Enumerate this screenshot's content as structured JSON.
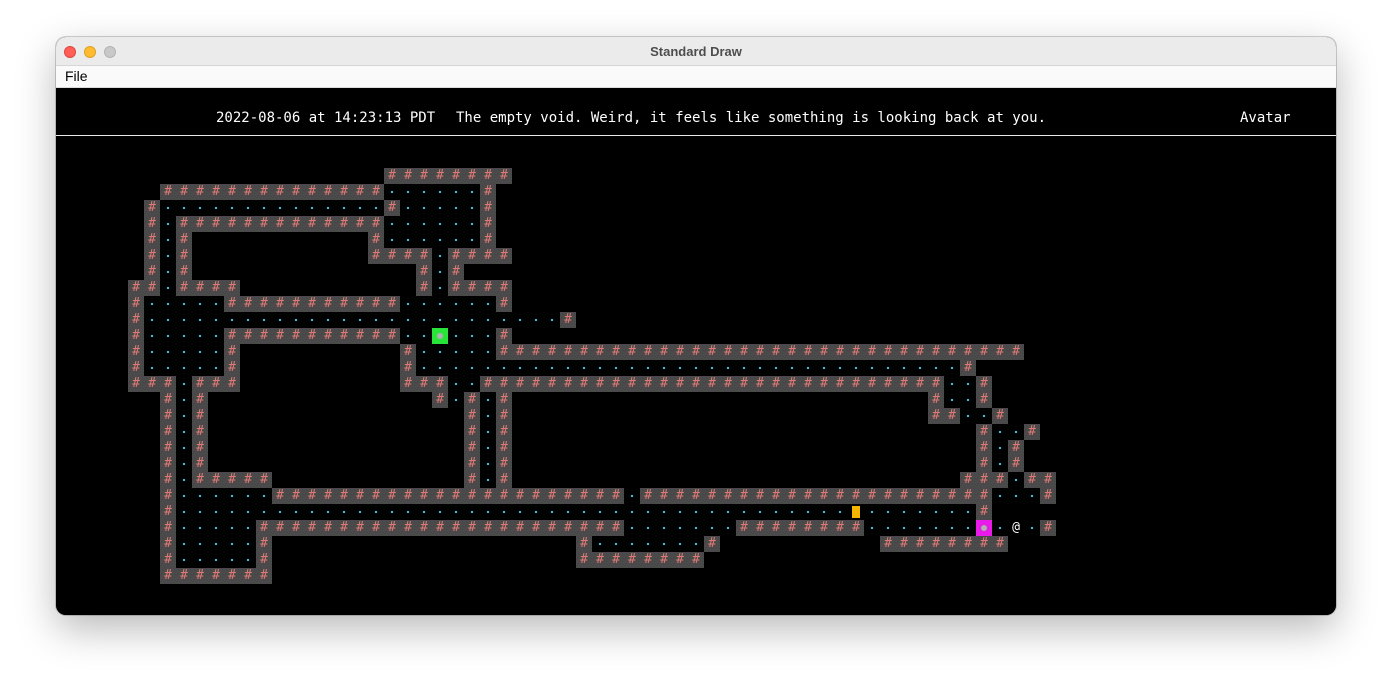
{
  "window": {
    "title": "Standard Draw",
    "menu": [
      "File"
    ]
  },
  "hud": {
    "datetime": "2022-08-06 at 14:23:13 PDT",
    "description": "The empty void. Weird, it feels like something is looking back at you.",
    "tile_name": "Avatar"
  },
  "colors": {
    "wall_bg": "#4a4a4a",
    "wall_glyph": "#e07a76",
    "floor_dot": "#3fc7d6",
    "background": "#000000",
    "green_tile": "#27e33a",
    "magenta_tile": "#e81be8",
    "orange_item": "#f5b400"
  },
  "map": {
    "legend": {
      "#": "wall",
      ".": "floor",
      "@": "avatar",
      "G": "green-tile",
      "M": "magenta-tile",
      "O": "orange-item"
    },
    "glyphs": {
      "wall": "#",
      "avatar": "@"
    },
    "rows": [
      "                    ########                               ",
      "      ##############......#                                ",
      "     #..............#.....#                                ",
      "     #.#############......#                                ",
      "     #.#           #......#                                ",
      "     #.#           ####.####                               ",
      "     #.#              #.#                                  ",
      "    ##.####           #.####                               ",
      "    #.....###########......#                               ",
      "    #..........................#                           ",
      "    #.....###########..G...#                               ",
      "    #.....#          #.....#################################",
      "    #.....#          #..................................#  ",
      "    ###.###          ###..#############################..#  ",
      "      #.#              #.#.#                          #..# ",
      "      #.#                #.#                          ##..# ",
      "      #.#                #.#                             #..#",
      "      #.#                #.#                             #.#",
      "      #.#                #.#                             #.#",
      "      #.#####            #.#                            ###.##",
      "      #......######################.######################...#",
      "      #..........................................O.......#",
      "      #.....#######################.......########.......M.@.#",
      "      #.....#                   #.......#          ######## ",
      "      #.....#                   ########                   ",
      "      #######                                              "
    ]
  }
}
